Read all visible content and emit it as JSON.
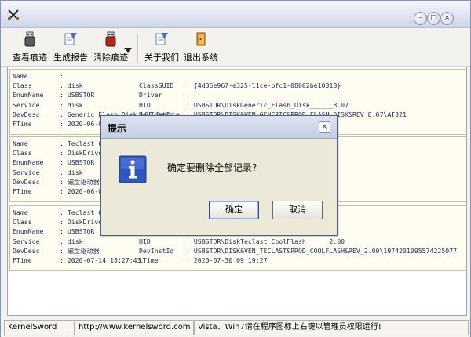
{
  "window": {
    "title": ""
  },
  "toolbar": {
    "items": [
      {
        "label": "查看痕迹"
      },
      {
        "label": "生成报告"
      },
      {
        "label": "清除痕迹"
      },
      {
        "label": "关于我们"
      },
      {
        "label": "退出系统"
      }
    ]
  },
  "records": [
    {
      "rows": [
        [
          "Name",
          ":",
          "",
          "",
          ""
        ],
        [
          "Class",
          ": disk",
          "ClassGUID",
          ": {4d36e967-e325-11ce-bfc1-08002be10318}",
          ""
        ],
        [
          "EnumName",
          ": USBSTOR",
          "Driver",
          ":",
          ""
        ],
        [
          "Service",
          ": disk",
          "HID",
          ": USBSTOR\\DiskGeneric_Flash_Disk______8.07",
          ""
        ],
        [
          "DevDesc",
          ": Generic Flash Disk USB Device",
          "DevInstId",
          ": USBSTOR\\DISK&VEN_GENERIC&PROD_FLASH_DISK&REV_8.07\\AF321",
          ""
        ],
        [
          "FTime",
          ": 2020-06-08 1",
          "",
          "",
          ""
        ]
      ]
    },
    {
      "rows": [
        [
          "Name",
          ": Teclast Cool",
          "",
          "",
          ""
        ],
        [
          "Class",
          ": DiskDrive",
          "",
          "",
          ""
        ],
        [
          "EnumName",
          ": USBSTOR",
          "",
          "}\\0001",
          ""
        ],
        [
          "Service",
          ": disk",
          "",
          "100",
          ""
        ],
        [
          "DevDesc",
          ": 磁盘驱动器",
          "",
          "SH_USB3.0&REV_1100\\AAIBBBB1JMB4",
          ""
        ],
        [
          "FTime",
          ": 2020-06-04 2",
          "",
          "",
          ""
        ]
      ]
    },
    {
      "rows": [
        [
          "Name",
          ": Teclast Cool",
          "",
          "",
          ""
        ],
        [
          "Class",
          ": DiskDrive",
          "",
          "",
          ""
        ],
        [
          "EnumName",
          ": USBSTOR",
          "",
          "}\\0002",
          ""
        ],
        [
          "Service",
          ": disk",
          "HID",
          ": USBSTOR\\DiskTeclast_CoolFlash______2.00",
          ""
        ],
        [
          "DevDesc",
          ": 磁盘驱动器",
          "DevInstId",
          ": USBSTOR\\DISK&VEN_TECLAST&PROD_COOLFLASH&REV_2.00\\1974201095574225077",
          ""
        ],
        [
          "FTime",
          ": 2020-07-14 18:27:43",
          "LTime",
          ": 2020-07-30 09:19:27",
          ""
        ]
      ]
    }
  ],
  "statusbar": {
    "app": "KernelSword",
    "url": "http://www.kernelsword.com",
    "notice": "Vista、Win7请在程序图标上右键以管理员权限运行!"
  },
  "dialog": {
    "title": "提示",
    "message": "确定要删除全部记录?",
    "ok": "确定",
    "cancel": "取消",
    "icon": "info-icon"
  }
}
